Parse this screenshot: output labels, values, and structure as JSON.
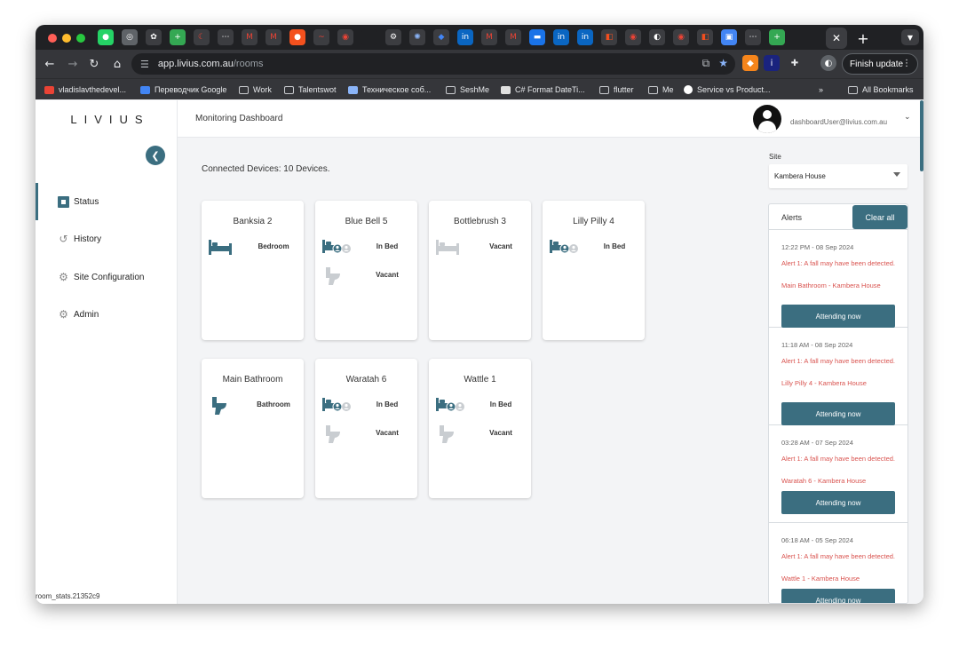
{
  "browser": {
    "url_host": "app.livius.com.au",
    "url_path": "/rooms",
    "finish_update": "Finish update",
    "bookmarks": [
      {
        "label": "vladislavthedevel...",
        "icon": "gmail-icon"
      },
      {
        "label": "Переводчик Google",
        "icon": "translate-icon"
      },
      {
        "label": "Work",
        "icon": "folder-icon"
      },
      {
        "label": "Talentswot",
        "icon": "folder-icon"
      },
      {
        "label": "Техническое соб...",
        "icon": "site-icon"
      },
      {
        "label": "SeshMe",
        "icon": "folder-icon"
      },
      {
        "label": "C# Format DateTi...",
        "icon": "doc-icon"
      },
      {
        "label": "flutter",
        "icon": "folder-icon"
      },
      {
        "label": "Me",
        "icon": "folder-icon"
      },
      {
        "label": "Service vs Product...",
        "icon": "site-icon"
      }
    ],
    "bookmarks_more": "»",
    "all_bookmarks": "All Bookmarks"
  },
  "app": {
    "logo": "LIVIUS",
    "header_title": "Monitoring Dashboard",
    "user_email": "dashboardUser@livius.com.au",
    "nav": [
      {
        "label": "Status",
        "icon": "status-icon"
      },
      {
        "label": "History",
        "icon": "history-icon"
      },
      {
        "label": "Site Configuration",
        "icon": "gear-icon"
      },
      {
        "label": "Admin",
        "icon": "gear-icon"
      }
    ],
    "build": "room_stats.21352c9",
    "connected": "Connected Devices: 10 Devices.",
    "site_label": "Site",
    "site_value": "Kambera House",
    "accent_color": "#3b6e80",
    "alert_color": "#d9534f"
  },
  "rooms": [
    {
      "name": "Banksia 2",
      "devices": [
        {
          "type": "bed",
          "active": true,
          "label": "Bedroom"
        }
      ]
    },
    {
      "name": "Blue Bell 5",
      "devices": [
        {
          "type": "bed-occupied",
          "active": true,
          "label": "In Bed"
        },
        {
          "type": "toilet",
          "active": false,
          "label": "Vacant"
        }
      ]
    },
    {
      "name": "Bottlebrush 3",
      "devices": [
        {
          "type": "bed",
          "active": false,
          "label": "Vacant"
        }
      ]
    },
    {
      "name": "Lilly Pilly 4",
      "devices": [
        {
          "type": "bed-occupied",
          "active": true,
          "label": "In Bed"
        }
      ]
    },
    {
      "name": "Main Bathroom",
      "devices": [
        {
          "type": "toilet",
          "active": true,
          "label": "Bathroom"
        }
      ]
    },
    {
      "name": "Waratah 6",
      "devices": [
        {
          "type": "bed-occupied",
          "active": true,
          "label": "In Bed"
        },
        {
          "type": "toilet",
          "active": false,
          "label": "Vacant"
        }
      ]
    },
    {
      "name": "Wattle 1",
      "devices": [
        {
          "type": "bed-occupied",
          "active": true,
          "label": "In Bed"
        },
        {
          "type": "toilet",
          "active": false,
          "label": "Vacant"
        }
      ]
    }
  ],
  "alerts": {
    "title": "Alerts",
    "clear_all": "Clear all",
    "items": [
      {
        "time": "12:22 PM - 08 Sep 2024",
        "message": "Alert 1: A fall may have been detected.",
        "location": "Main Bathroom - Kambera House",
        "action": "Attending now"
      },
      {
        "time": "11:18 AM - 08 Sep 2024",
        "message": "Alert 1: A fall may have been detected.",
        "location": "Lilly Pilly 4 - Kambera House",
        "action": "Attending now"
      },
      {
        "time": "03:28 AM - 07 Sep 2024",
        "message": "Alert 1: A fall may have been detected.",
        "location": "Waratah 6 - Kambera House",
        "action": "Attending now"
      },
      {
        "time": "06:18 AM - 05 Sep 2024",
        "message": "Alert 1: A fall may have been detected.",
        "location": "Wattle 1 - Kambera House",
        "action": "Attending now"
      }
    ]
  }
}
